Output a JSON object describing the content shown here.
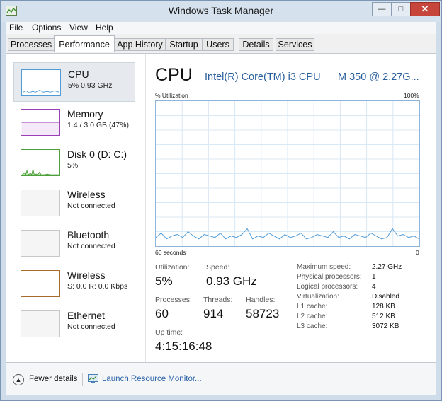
{
  "window": {
    "title": "Windows Task Manager",
    "min_glyph": "—",
    "max_glyph": "□",
    "close_glyph": "✕"
  },
  "menu": [
    "File",
    "Options",
    "View",
    "Help"
  ],
  "tabs": [
    {
      "label": "Processes",
      "active": false
    },
    {
      "label": "Performance",
      "active": true
    },
    {
      "label": "App History",
      "active": false
    },
    {
      "label": "Startup",
      "active": false
    },
    {
      "label": "Users",
      "active": false
    },
    {
      "label": "Details",
      "active": false
    },
    {
      "label": "Services",
      "active": false
    }
  ],
  "resources": [
    {
      "name": "CPU",
      "sub": "5% 0.93 GHz",
      "color": "#4f9bd8",
      "selected": true
    },
    {
      "name": "Memory",
      "sub": "1.4 / 3.0 GB (47%)",
      "color": "#9b3fb6",
      "selected": false
    },
    {
      "name": "Disk 0 (D: C:)",
      "sub": "5%",
      "color": "#4da03a",
      "selected": false
    },
    {
      "name": "Wireless",
      "sub": "Not connected",
      "color": "#b5b5b5",
      "selected": false
    },
    {
      "name": "Bluetooth",
      "sub": "Not connected",
      "color": "#b5b5b5",
      "selected": false
    },
    {
      "name": "Wireless",
      "sub": "S: 0.0 R: 0.0 Kbps",
      "color": "#a86a2a",
      "selected": false
    },
    {
      "name": "Ethernet",
      "sub": "Not connected",
      "color": "#b5b5b5",
      "selected": false
    }
  ],
  "cpu": {
    "title": "CPU",
    "model": "Intel(R) Core(TM) i3 CPU",
    "model_speed": "M 350  @ 2.27G...",
    "utilization_label": "% Utilization",
    "max_label": "100%",
    "time_label": "60 seconds",
    "zero_label": "0",
    "graph_color": "#4f9bd8",
    "utilization_history": [
      6,
      9,
      5,
      7,
      8,
      6,
      10,
      7,
      5,
      8,
      7,
      6,
      9,
      5,
      7,
      6,
      8,
      12,
      5,
      7,
      6,
      9,
      7,
      5,
      8,
      6,
      7,
      9,
      5,
      6,
      8,
      7,
      6,
      10,
      6,
      7,
      5,
      8,
      7,
      6,
      9,
      7,
      5,
      6,
      12,
      7,
      8,
      6,
      7,
      5
    ]
  },
  "stats": {
    "utilization": {
      "label": "Utilization:",
      "value": "5%"
    },
    "speed": {
      "label": "Speed:",
      "value": "0.93 GHz"
    },
    "processes": {
      "label": "Processes:",
      "value": "60"
    },
    "threads": {
      "label": "Threads:",
      "value": "914"
    },
    "handles": {
      "label": "Handles:",
      "value": "58723"
    },
    "uptime": {
      "label": "Up time:",
      "value": "4:15:16:48"
    }
  },
  "specs": [
    {
      "label": "Maximum speed:",
      "value": "2.27 GHz"
    },
    {
      "label": "Physical processors:",
      "value": "1"
    },
    {
      "label": "Logical processors:",
      "value": "4"
    },
    {
      "label": "Virtualization:",
      "value": "Disabled"
    },
    {
      "label": "L1 cache:",
      "value": "128 KB"
    },
    {
      "label": "L2 cache:",
      "value": "512 KB"
    },
    {
      "label": "L3 cache:",
      "value": "3072 KB"
    }
  ],
  "footer": {
    "fewer_details": "Fewer details",
    "launch_monitor": "Launch Resource Monitor..."
  }
}
